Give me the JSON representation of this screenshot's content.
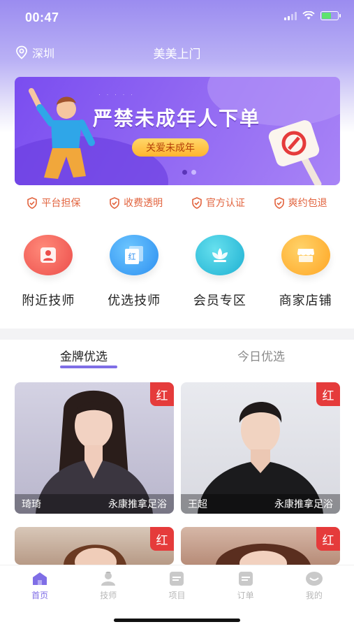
{
  "status_bar": {
    "time": "00:47"
  },
  "nav": {
    "location": "深圳",
    "title": "美美上门"
  },
  "banner": {
    "headline": "严禁未成年人下单",
    "tag": "关爱未成年"
  },
  "guarantees": [
    "平台担保",
    "收费透明",
    "官方认证",
    "爽约包退"
  ],
  "categories": [
    {
      "label": "附近技师",
      "icon": "person-icon",
      "color": "#f0665f"
    },
    {
      "label": "优选技师",
      "icon": "hongbao-icon",
      "color": "#3fa3f5"
    },
    {
      "label": "会员专区",
      "icon": "lotus-icon",
      "color": "#2fc0dc"
    },
    {
      "label": "商家店铺",
      "icon": "shop-icon",
      "color": "#ffb42e"
    }
  ],
  "category_badge_text": "红",
  "tabs": [
    {
      "label": "金牌优选",
      "active": true
    },
    {
      "label": "今日优选",
      "active": false
    }
  ],
  "technicians": [
    {
      "name": "琦琦",
      "service": "永康推拿足浴",
      "badge": "红"
    },
    {
      "name": "王超",
      "service": "永康推拿足浴",
      "badge": "红"
    },
    {
      "badge": "红"
    },
    {
      "badge": "红"
    }
  ],
  "tabbar": [
    {
      "label": "首页",
      "icon": "home-icon",
      "active": true
    },
    {
      "label": "技师",
      "icon": "technician-icon",
      "active": false
    },
    {
      "label": "项目",
      "icon": "project-icon",
      "active": false
    },
    {
      "label": "订单",
      "icon": "order-icon",
      "active": false
    },
    {
      "label": "我的",
      "icon": "profile-icon",
      "active": false
    }
  ],
  "colors": {
    "accent": "#7f6ee6",
    "guarantee": "#e2643f",
    "badge": "#e53b3b"
  }
}
